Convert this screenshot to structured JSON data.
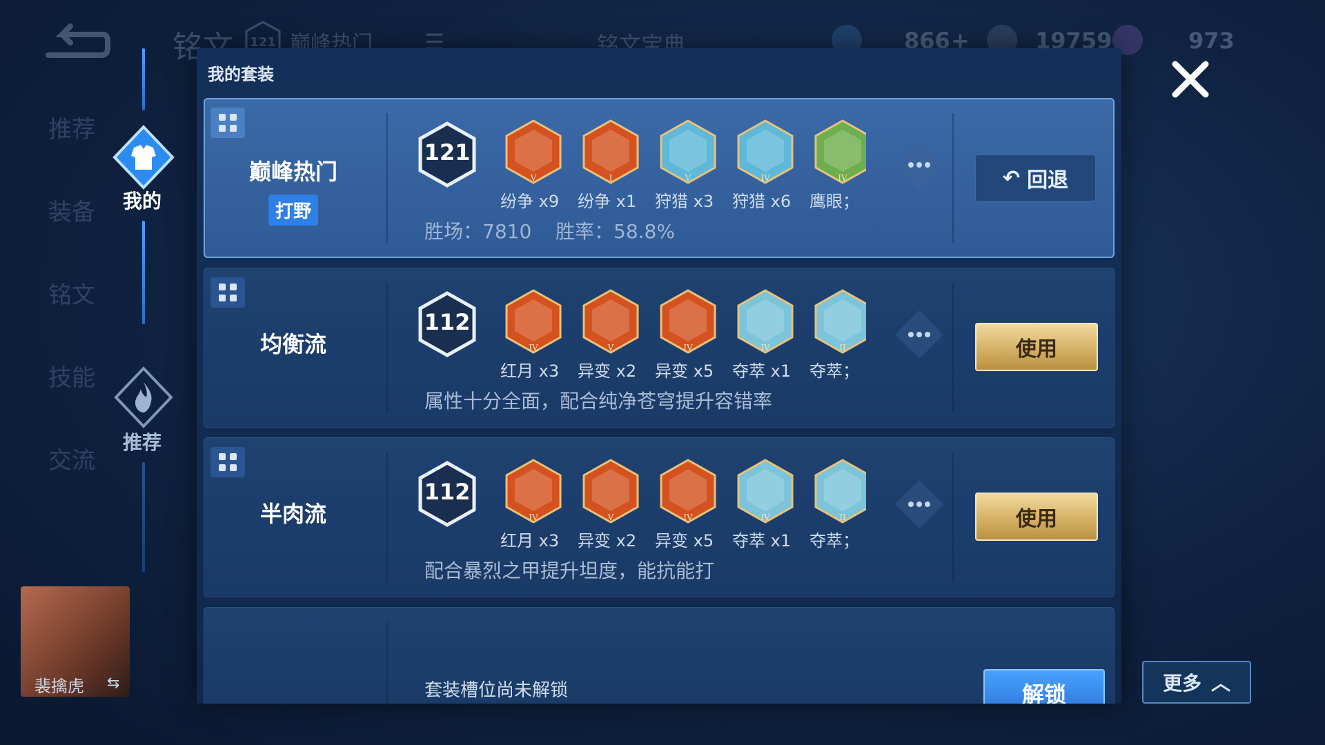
{
  "background": {
    "title": "铭文",
    "preset_level": "121",
    "preset_name": "巅峰热门",
    "codex_label": "铭文宝典",
    "resources": [
      {
        "name": "fragments",
        "value": "866"
      },
      {
        "name": "coins",
        "value": "19759"
      },
      {
        "name": "gems",
        "value": "973"
      }
    ],
    "side_nav": [
      "推荐",
      "装备",
      "铭文",
      "技能",
      "交流"
    ],
    "hero_name": "裴擒虎"
  },
  "rail": {
    "my_label": "我的",
    "recommend_label": "推荐"
  },
  "panel": {
    "title": "我的套装",
    "cards": [
      {
        "name": "巅峰热门",
        "tag": "打野",
        "level": "121",
        "inscriptions": [
          {
            "label": "纷争 x9",
            "color": "#d4521f",
            "tier": "V"
          },
          {
            "label": "纷争 x1",
            "color": "#d4521f",
            "tier": "I"
          },
          {
            "label": "狩猎 x3",
            "color": "#5fb8d8",
            "tier": "V"
          },
          {
            "label": "狩猎 x6",
            "color": "#5fb8d8",
            "tier": "IV"
          },
          {
            "label": "鹰眼；",
            "color": "#6fae4e",
            "tier": "IV"
          }
        ],
        "stat_wins_label": "胜场：7810",
        "stat_rate_label": "胜率：58.8%",
        "button": "回退"
      },
      {
        "name": "均衡流",
        "level": "112",
        "inscriptions": [
          {
            "label": "红月 x3",
            "color": "#d4521f",
            "tier": "IV"
          },
          {
            "label": "异变 x2",
            "color": "#d4521f",
            "tier": "V"
          },
          {
            "label": "异变 x5",
            "color": "#d4521f",
            "tier": "IV"
          },
          {
            "label": "夺萃 x1",
            "color": "#7cc4da",
            "tier": "IV"
          },
          {
            "label": "夺萃；",
            "color": "#7cc4da",
            "tier": "II"
          }
        ],
        "description": "属性十分全面，配合纯净苍穹提升容错率",
        "button": "使用"
      },
      {
        "name": "半肉流",
        "level": "112",
        "inscriptions": [
          {
            "label": "红月 x3",
            "color": "#d4521f",
            "tier": "IV"
          },
          {
            "label": "异变 x2",
            "color": "#d4521f",
            "tier": "V"
          },
          {
            "label": "异变 x5",
            "color": "#d4521f",
            "tier": "IV"
          },
          {
            "label": "夺萃 x1",
            "color": "#7cc4da",
            "tier": "IV"
          },
          {
            "label": "夺萃；",
            "color": "#7cc4da",
            "tier": "II"
          }
        ],
        "description": "配合暴烈之甲提升坦度，能抗能打",
        "button": "使用"
      },
      {
        "locked_text": "套装槽位尚未解锁",
        "button": "解锁"
      }
    ]
  },
  "more_button": "更多"
}
